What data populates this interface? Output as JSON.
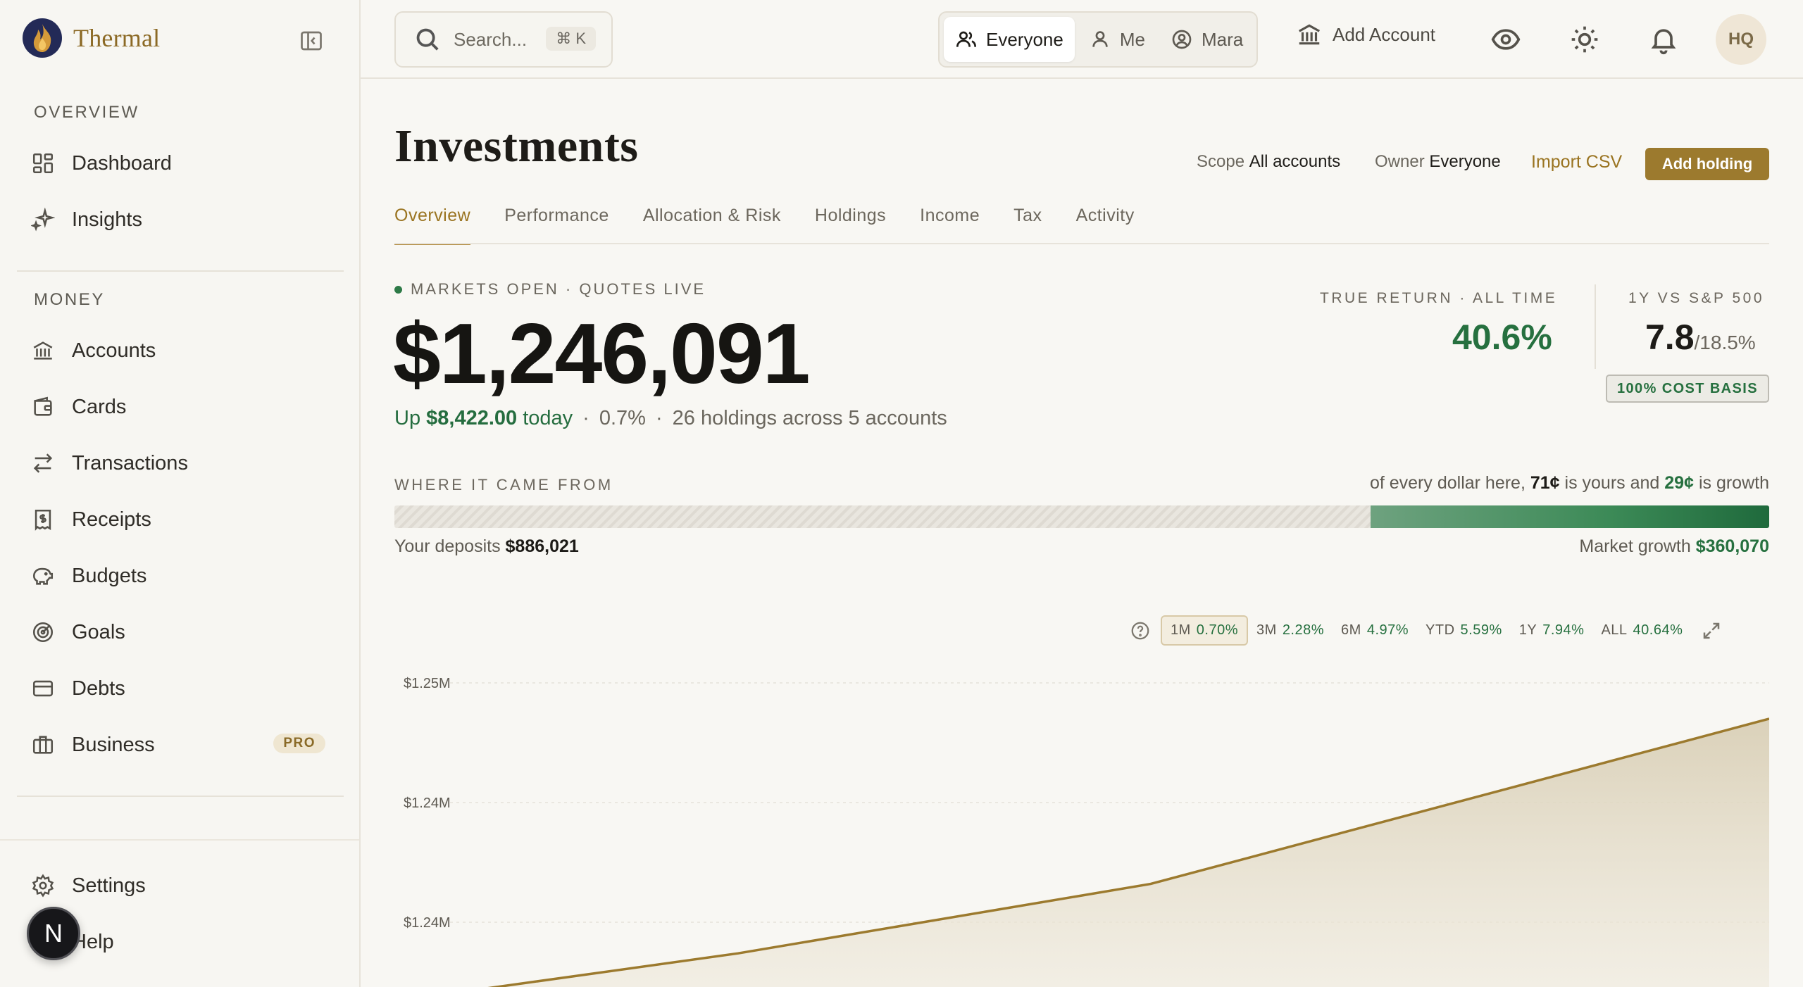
{
  "app": {
    "name": "Thermal"
  },
  "sidebar": {
    "sections": [
      {
        "heading": "OVERVIEW",
        "items": [
          {
            "label": "Dashboard",
            "icon": "dashboard-icon"
          },
          {
            "label": "Insights",
            "icon": "sparkle-icon"
          }
        ]
      },
      {
        "heading": "MONEY",
        "items": [
          {
            "label": "Accounts",
            "icon": "bank-icon"
          },
          {
            "label": "Cards",
            "icon": "wallet-icon"
          },
          {
            "label": "Transactions",
            "icon": "transfer-icon"
          },
          {
            "label": "Receipts",
            "icon": "receipt-icon"
          },
          {
            "label": "Budgets",
            "icon": "piggy-bank-icon"
          },
          {
            "label": "Goals",
            "icon": "target-icon"
          },
          {
            "label": "Debts",
            "icon": "credit-card-icon"
          },
          {
            "label": "Business",
            "icon": "briefcase-icon",
            "badge": "PRO"
          }
        ]
      }
    ],
    "footer": [
      {
        "label": "Settings",
        "icon": "gear-icon"
      },
      {
        "label": "Help",
        "icon": "help-icon"
      }
    ],
    "floating_button": "N"
  },
  "topbar": {
    "search_placeholder": "Search...",
    "shortcut": "⌘ K",
    "segments": [
      {
        "label": "Everyone",
        "active": true
      },
      {
        "label": "Me"
      },
      {
        "label": "Mara"
      }
    ],
    "add_account": "Add Account",
    "avatar": "HQ"
  },
  "page": {
    "title": "Investments",
    "scope_label": "Scope",
    "scope_value": "All accounts",
    "owner_label": "Owner",
    "owner_value": "Everyone",
    "import_csv": "Import CSV",
    "add_holding": "Add holding",
    "tabs": [
      "Overview",
      "Performance",
      "Allocation & Risk",
      "Holdings",
      "Income",
      "Tax",
      "Activity"
    ],
    "active_tab": "Overview"
  },
  "summary": {
    "status": "MARKETS OPEN · QUOTES LIVE",
    "total_value": "$1,246,091",
    "up_prefix": "Up",
    "up_amount": "$8,422.00",
    "up_suffix": "today",
    "day_pct": "0.7%",
    "holdings_text": "26 holdings across 5 accounts",
    "true_return_label": "TRUE RETURN · ALL TIME",
    "true_return_value": "40.6%",
    "vs_label": "1Y VS S&P 500",
    "vs_value": "7.8",
    "vs_bench": "/18.5%",
    "cost_basis_badge": "100% COST BASIS"
  },
  "origin": {
    "label": "WHERE IT CAME FROM",
    "dollar_prefix": "of every dollar here,",
    "yours": "71¢",
    "dollar_mid": "is yours and",
    "growth": "29¢",
    "dollar_suffix": "is growth",
    "deposits_label": "Your deposits",
    "deposits_value": "$886,021",
    "growth_label": "Market growth",
    "growth_value": "$360,070",
    "deposits_fraction": 0.71,
    "deposit_color": "#e6e3dc",
    "growth_color": "#2e7a47"
  },
  "ranges": [
    {
      "label": "1M",
      "pct": "0.70%",
      "active": true
    },
    {
      "label": "3M",
      "pct": "2.28%"
    },
    {
      "label": "6M",
      "pct": "4.97%"
    },
    {
      "label": "YTD",
      "pct": "5.59%"
    },
    {
      "label": "1Y",
      "pct": "7.94%"
    },
    {
      "label": "ALL",
      "pct": "40.64%"
    }
  ],
  "chart_data": {
    "type": "area",
    "title": "",
    "xlabel": "",
    "ylabel": "",
    "y_ticks": [
      "$1.25M",
      "$1.24M",
      "$1.24M"
    ],
    "y_tick_values": [
      1250000,
      1245000,
      1240000
    ],
    "ylim": [
      1234500,
      1251500
    ],
    "x": [
      0,
      0.25,
      0.55,
      1.0
    ],
    "values": [
      1236700,
      1238700,
      1241600,
      1248500
    ],
    "series": [
      {
        "values": [
          1236700,
          1238700,
          1241600,
          1248500
        ]
      }
    ],
    "grid": true,
    "line_color": "#9c7a2e"
  }
}
